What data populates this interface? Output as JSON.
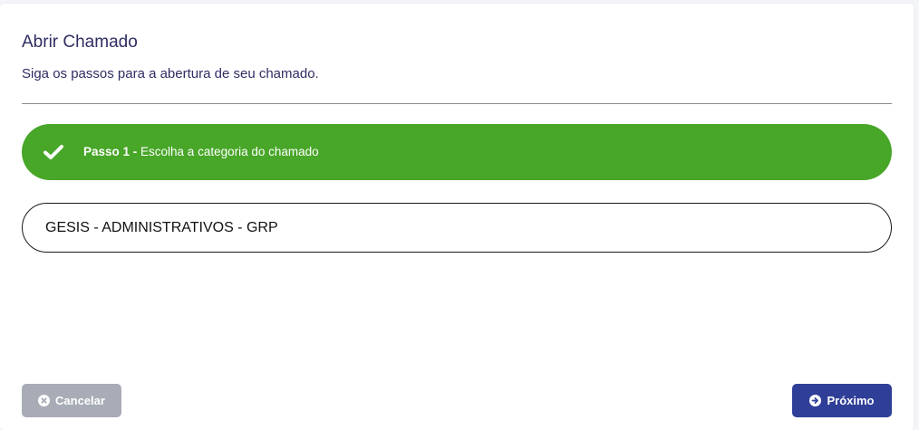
{
  "header": {
    "title": "Abrir Chamado",
    "subtitle": "Siga os passos para a abertura de seu chamado."
  },
  "step": {
    "icon": "check-icon",
    "label_bold": "Passo 1 -",
    "label_rest": " Escolha a categoria do chamado",
    "color": "#48a628",
    "status": "completed"
  },
  "category": {
    "selected_label": "GESIS - ADMINISTRATIVOS - GRP"
  },
  "actions": {
    "cancel_label": "Cancelar",
    "cancel_icon": "times-circle-icon",
    "cancel_color": "#a8acb6",
    "next_label": "Próximo",
    "next_icon": "arrow-circle-right-icon",
    "next_color": "#2f3f98"
  },
  "colors": {
    "title_text": "#2e2d63"
  }
}
